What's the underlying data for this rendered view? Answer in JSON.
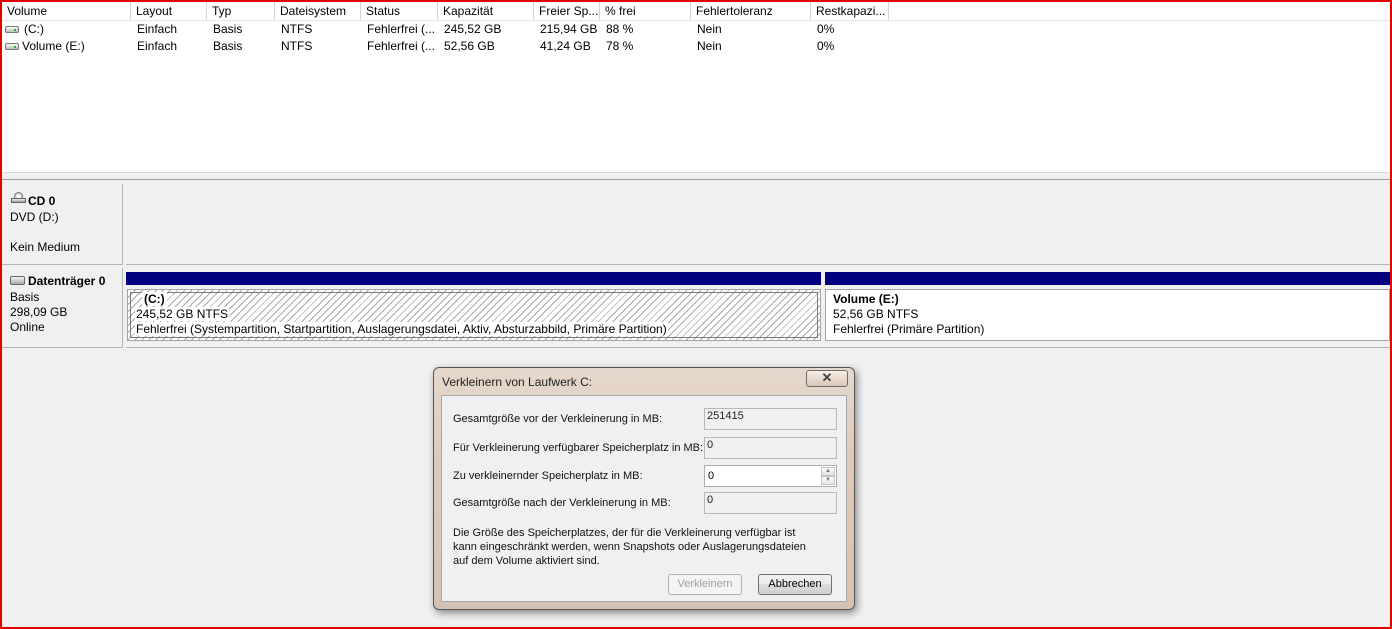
{
  "volume_list": {
    "columns": [
      {
        "label": "Volume"
      },
      {
        "label": "Layout"
      },
      {
        "label": "Typ"
      },
      {
        "label": "Dateisystem"
      },
      {
        "label": "Status"
      },
      {
        "label": "Kapazität"
      },
      {
        "label": "Freier Sp..."
      },
      {
        "label": "% frei"
      },
      {
        "label": "Fehlertoleranz"
      },
      {
        "label": "Restkapazi..."
      }
    ],
    "rows": [
      {
        "volume": "(C:)",
        "layout": "Einfach",
        "type": "Basis",
        "filesystem": "NTFS",
        "status": "Fehlerfrei (...",
        "capacity": "245,52 GB",
        "free": "215,94 GB",
        "percent_free": "88 %",
        "fault_tolerance": "Nein",
        "overhead": "0%"
      },
      {
        "volume": "Volume (E:)",
        "layout": "Einfach",
        "type": "Basis",
        "filesystem": "NTFS",
        "status": "Fehlerfrei (...",
        "capacity": "52,56 GB",
        "free": "41,24 GB",
        "percent_free": "78 %",
        "fault_tolerance": "Nein",
        "overhead": "0%"
      }
    ]
  },
  "disk_map": {
    "cd0": {
      "name": "CD 0",
      "drive": "DVD (D:)",
      "status": "Kein Medium",
      "icon": "cd-drive-icon"
    },
    "disk0": {
      "name": "Datenträger 0",
      "type": "Basis",
      "size": "298,09 GB",
      "status": "Online",
      "icon": "hard-disk-icon",
      "bar_color": "#00007f",
      "partitions": [
        {
          "name": "(C:)",
          "size_fs": "245,52 GB NTFS",
          "status": "Fehlerfrei (Systempartition, Startpartition, Auslagerungsdatei, Aktiv, Absturzabbild, Primäre Partition)"
        },
        {
          "name": "Volume  (E:)",
          "size_fs": "52,56 GB NTFS",
          "status": "Fehlerfrei (Primäre Partition)"
        }
      ]
    }
  },
  "dialog": {
    "title": "Verkleinern von Laufwerk C:",
    "close_glyph": "☒",
    "fields": {
      "total_before": {
        "label": "Gesamtgröße vor der Verkleinerung in MB:",
        "value": "251415"
      },
      "available": {
        "label": "Für Verkleinerung verfügbarer Speicherplatz in MB:",
        "value": "0"
      },
      "to_shrink": {
        "label": "Zu verkleinernder Speicherplatz in MB:",
        "value": "0"
      },
      "total_after": {
        "label": "Gesamtgröße nach der Verkleinerung in MB:",
        "value": "0"
      }
    },
    "description": [
      "Die Größe des Speicherplatzes, der für die Verkleinerung verfügbar ist",
      "kann eingeschränkt werden, wenn Snapshots oder Auslagerungsdateien",
      "auf dem Volume aktiviert sind."
    ],
    "buttons": {
      "shrink": "Verkleinern",
      "cancel": "Abbrechen"
    },
    "spin_up": "▲",
    "spin_down": "▼"
  },
  "colors": {
    "frame_border": "#e00000",
    "partition_bar": "#00007f"
  }
}
